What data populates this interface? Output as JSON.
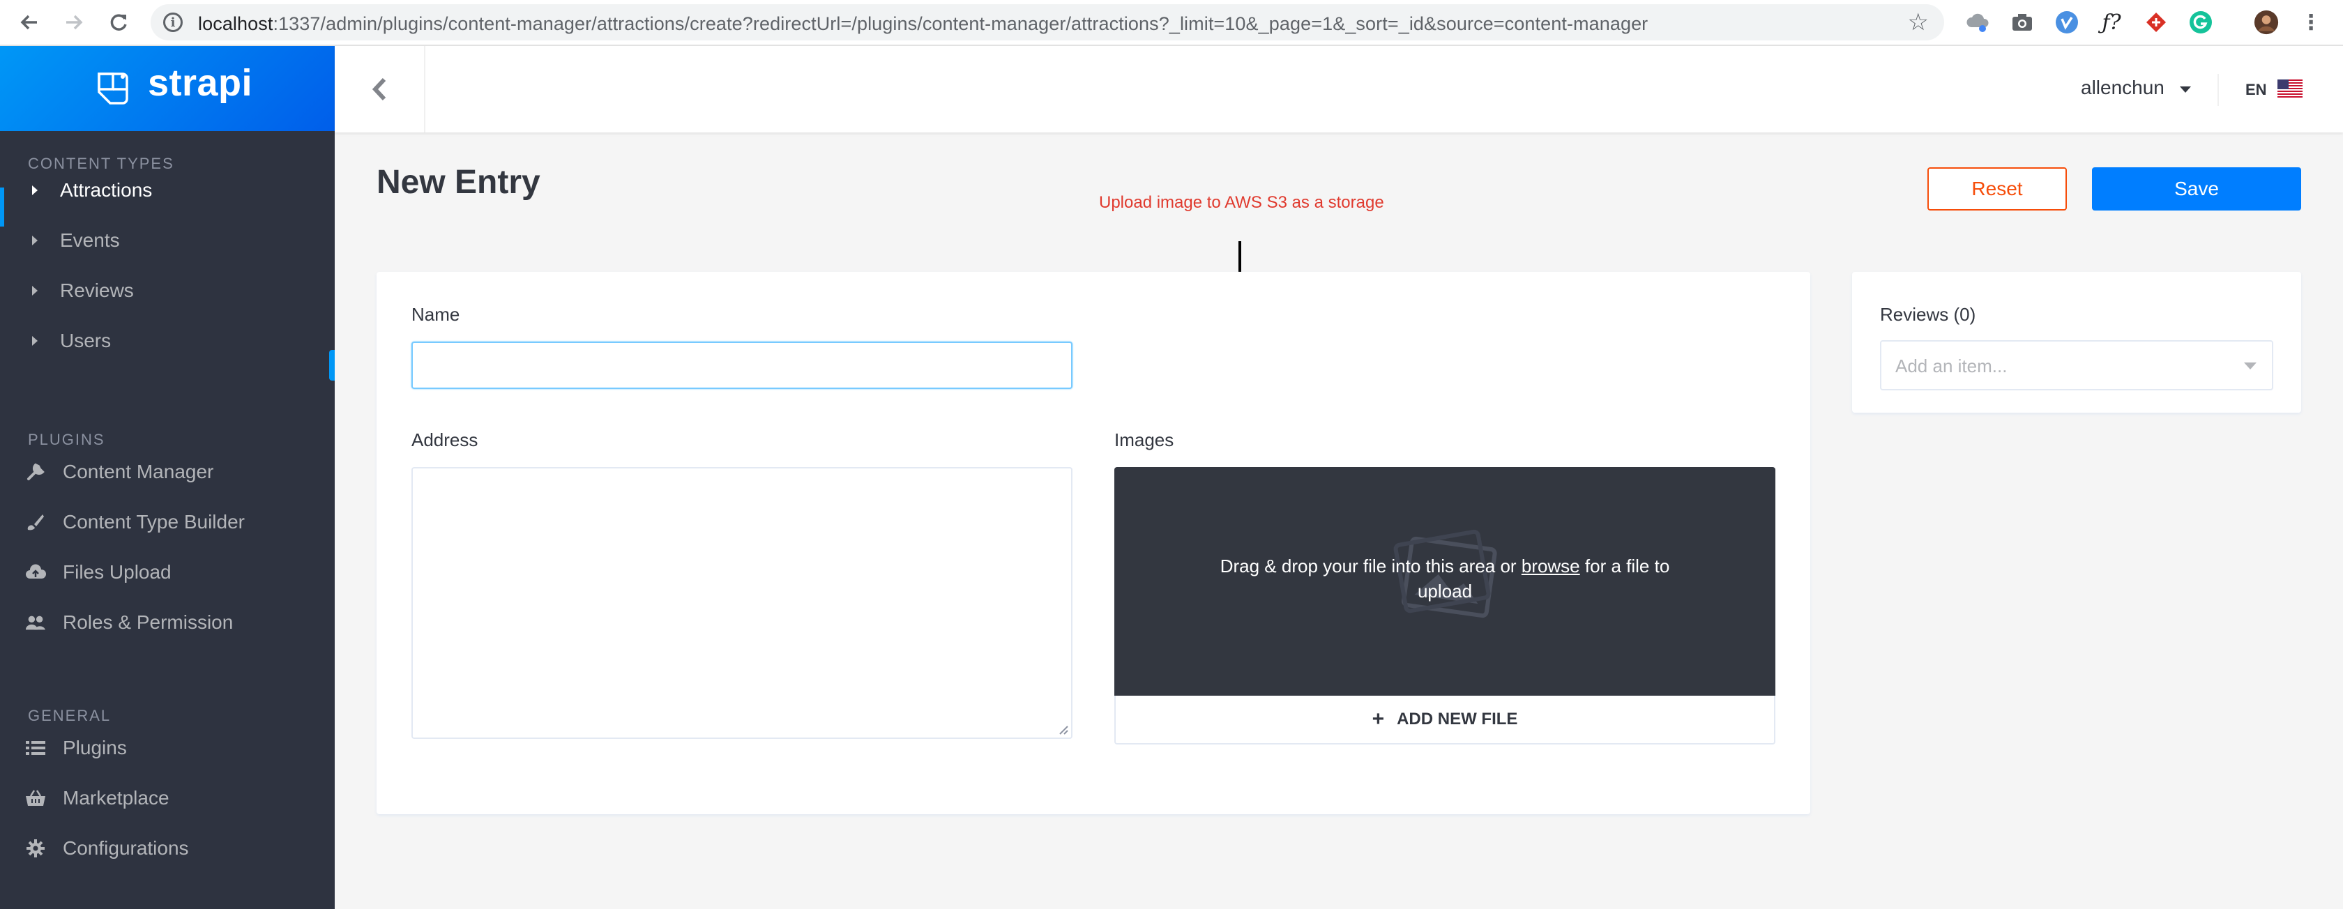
{
  "browser": {
    "url_host": "localhost",
    "url_rest": ":1337/admin/plugins/content-manager/attractions/create?redirectUrl=/plugins/content-manager/attractions?_limit=10&_page=1&_sort=_id&source=content-manager"
  },
  "sidebar": {
    "brand": "strapi",
    "content_types_label": "Content Types",
    "content_types": [
      {
        "label": "Attractions",
        "active": true
      },
      {
        "label": "Events"
      },
      {
        "label": "Reviews"
      },
      {
        "label": "Users"
      }
    ],
    "plugins_label": "Plugins",
    "plugins": [
      {
        "label": "Content Manager",
        "icon": "wrench-icon"
      },
      {
        "label": "Content Type Builder",
        "icon": "paintbrush-icon"
      },
      {
        "label": "Files Upload",
        "icon": "cloud-upload-icon"
      },
      {
        "label": "Roles & Permission",
        "icon": "users-icon"
      }
    ],
    "general_label": "General",
    "general": [
      {
        "label": "Plugins",
        "icon": "list-icon"
      },
      {
        "label": "Marketplace",
        "icon": "basket-icon"
      },
      {
        "label": "Configurations",
        "icon": "gear-icon"
      }
    ]
  },
  "header": {
    "user": "allenchun",
    "lang": "EN"
  },
  "page": {
    "title": "New Entry",
    "annotation": "Upload image to AWS S3 as a storage",
    "reset_label": "Reset",
    "save_label": "Save"
  },
  "form": {
    "name_label": "Name",
    "name_value": "",
    "address_label": "Address",
    "images_label": "Images",
    "drop_text_before": "Drag & drop your file into this area or ",
    "drop_link": "browse",
    "drop_text_after": " for a file to upload",
    "add_file_label": "ADD NEW FILE"
  },
  "relations": {
    "reviews_label": "Reviews (0)",
    "reviews_placeholder": "Add an item..."
  },
  "colors": {
    "primary": "#007eff",
    "reset": "#f64d0a",
    "annotation": "#e03a2e",
    "sidebar": "#2e3340"
  }
}
